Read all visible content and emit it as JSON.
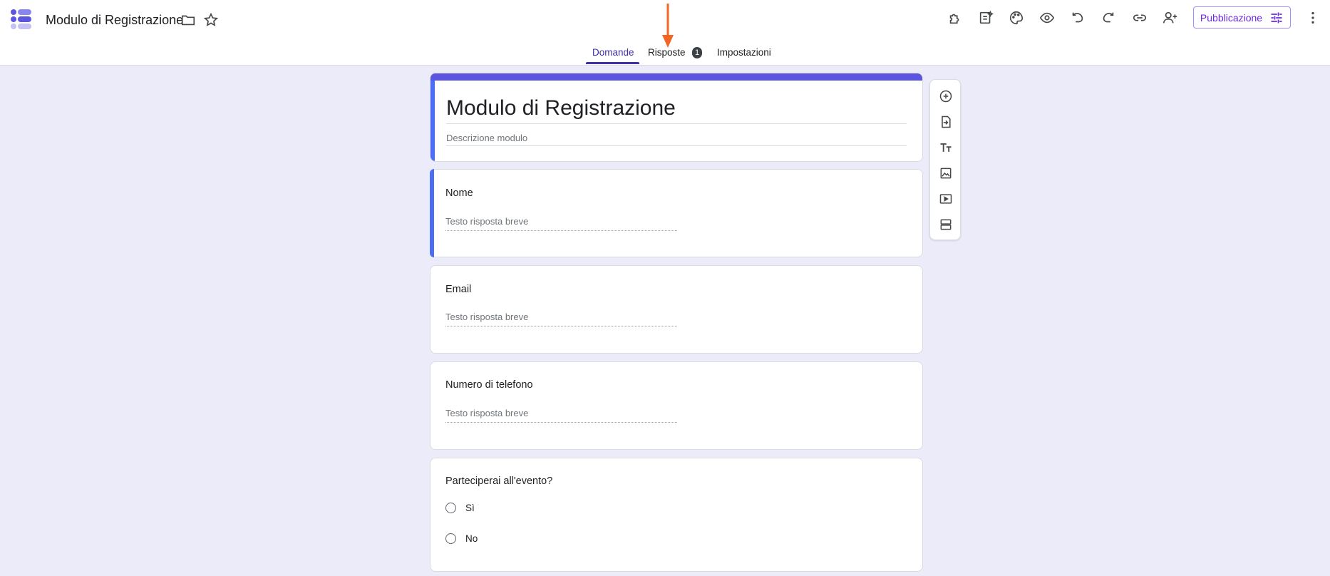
{
  "header": {
    "doc_title": "Modulo di Registrazione",
    "publish_label": "Pubblicazione",
    "accent_color": "#6d28d9"
  },
  "tabs": [
    {
      "label": "Domande",
      "active": true
    },
    {
      "label": "Risposte",
      "badge": "1"
    },
    {
      "label": "Impostazioni"
    }
  ],
  "form": {
    "title": "Modulo di Registrazione",
    "description_placeholder": "Descrizione modulo"
  },
  "questions": [
    {
      "label": "Nome",
      "answer_placeholder": "Testo risposta breve"
    },
    {
      "label": "Email",
      "answer_placeholder": "Testo risposta breve"
    },
    {
      "label": "Numero di telefono",
      "answer_placeholder": "Testo risposta breve"
    },
    {
      "label": "Parteciperai all'evento?",
      "options": [
        "Sì",
        "No"
      ]
    }
  ],
  "icons": {
    "header": [
      "folder-icon",
      "star-icon",
      "addons-icon",
      "ai-form-icon",
      "palette-icon",
      "preview-icon",
      "undo-icon",
      "redo-icon",
      "link-icon",
      "add-collaborator-icon",
      "more-vert-icon"
    ],
    "side_toolbar": [
      "add-question-icon",
      "import-questions-icon",
      "add-title-icon",
      "add-image-icon",
      "add-video-icon",
      "add-section-icon"
    ]
  }
}
